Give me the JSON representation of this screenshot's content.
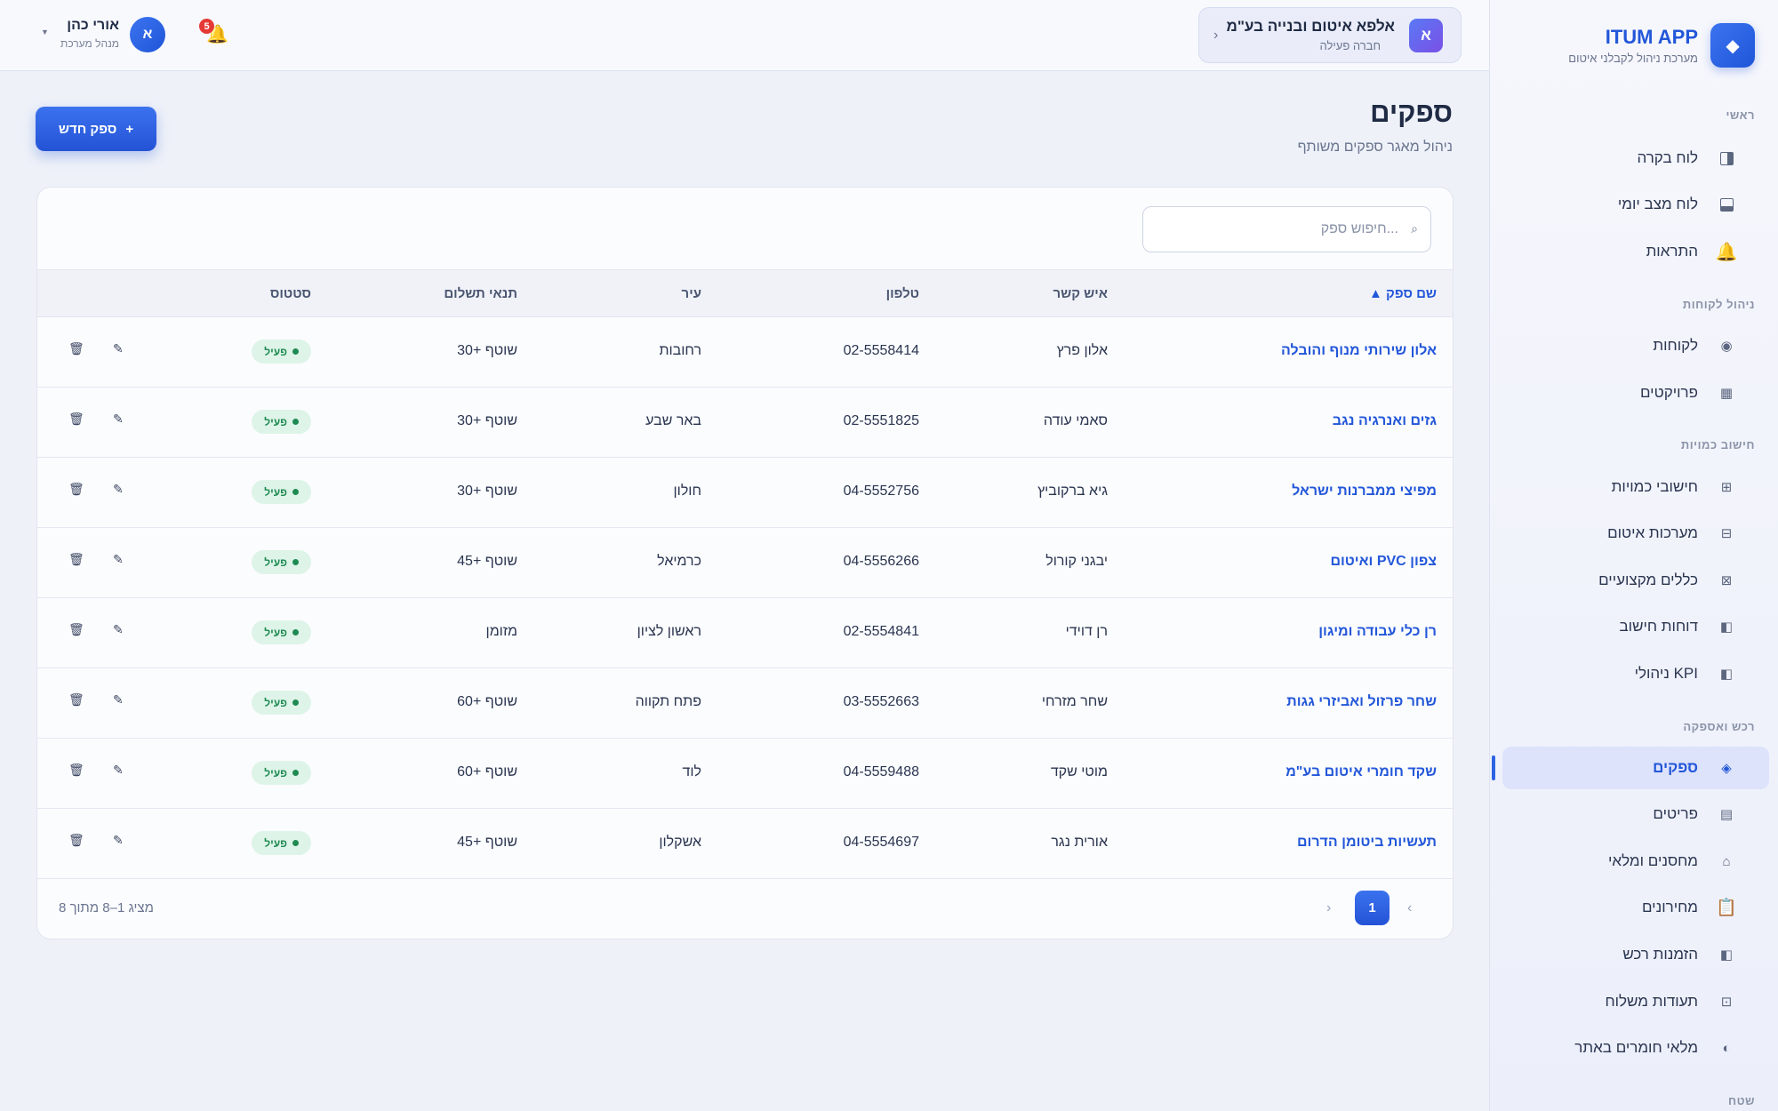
{
  "app": {
    "title": "ITUM APP",
    "subtitle": "מערכת ניהול לקבלני איטום",
    "logo_icon": "diamond-icon"
  },
  "sidebar": {
    "sections": [
      {
        "label": "ראשי"
      },
      {
        "label": "ניהול לקוחות"
      },
      {
        "label": "חישוב כמויות"
      },
      {
        "label": "רכש ואספקה"
      },
      {
        "label": "שטח"
      }
    ],
    "items": [
      {
        "label": "לוח בקרה",
        "icon": "dashboard-icon"
      },
      {
        "label": "לוח מצב יומי",
        "icon": "daily-board-icon"
      },
      {
        "label": "התראות",
        "icon": "bell-icon"
      },
      {
        "label": "לקוחות",
        "icon": "customers-icon"
      },
      {
        "label": "פרויקטים",
        "icon": "projects-icon"
      },
      {
        "label": "חישובי כמויות",
        "icon": "calc-grid-icon"
      },
      {
        "label": "מערכות איטום",
        "icon": "systems-icon"
      },
      {
        "label": "כללים מקצועיים",
        "icon": "rules-icon"
      },
      {
        "label": "דוחות חישוב",
        "icon": "report-icon"
      },
      {
        "label": "KPI ניהולי",
        "icon": "kpi-icon"
      },
      {
        "label": "ספקים",
        "icon": "suppliers-icon",
        "active": true
      },
      {
        "label": "פריטים",
        "icon": "items-icon"
      },
      {
        "label": "מחסנים ומלאי",
        "icon": "warehouse-icon"
      },
      {
        "label": "מחירונים",
        "icon": "clipboard-icon"
      },
      {
        "label": "הזמנות רכש",
        "icon": "purchase-icon"
      },
      {
        "label": "תעודות משלוח",
        "icon": "delivery-icon"
      },
      {
        "label": "מלאי חומרים באתר",
        "icon": "site-stock-icon"
      }
    ]
  },
  "topbar": {
    "company": {
      "avatar": "א",
      "name": "אלפא איטום ובנייה בע\"מ",
      "status": "חברה פעילה"
    },
    "user": {
      "avatar": "א",
      "name": "אורי כהן",
      "role": "מנהל מערכת"
    },
    "notifications": {
      "count": "5"
    }
  },
  "page": {
    "title": "ספקים",
    "subtitle": "ניהול מאגר ספקים משותף",
    "new_button": "ספק חדש",
    "new_button_icon": "+"
  },
  "search": {
    "placeholder": "...חיפוש ספק",
    "value": ""
  },
  "table": {
    "columns": [
      "שם ספק ▲",
      "איש קשר",
      "טלפון",
      "עיר",
      "תנאי תשלום",
      "סטטוס"
    ],
    "sorted_column": "שם ספק",
    "rows": [
      {
        "name": "אלון שירותי מנוף והובלה",
        "contact": "אלון פרץ",
        "phone": "02-5558414",
        "city": "רחובות",
        "terms": "שוטף +30",
        "status": "פעיל"
      },
      {
        "name": "גזים ואנרגיה נגב",
        "contact": "סאמי עודה",
        "phone": "02-5551825",
        "city": "באר שבע",
        "terms": "שוטף +30",
        "status": "פעיל"
      },
      {
        "name": "מפיצי ממברנות ישראל",
        "contact": "גיא ברקוביץ",
        "phone": "04-5552756",
        "city": "חולון",
        "terms": "שוטף +30",
        "status": "פעיל"
      },
      {
        "name": "צפון PVC ואיטום",
        "contact": "יבגני קורול",
        "phone": "04-5556266",
        "city": "כרמיאל",
        "terms": "שוטף +45",
        "status": "פעיל"
      },
      {
        "name": "רן כלי עבודה ומיגון",
        "contact": "רן דוידי",
        "phone": "02-5554841",
        "city": "ראשון לציון",
        "terms": "מזומן",
        "status": "פעיל"
      },
      {
        "name": "שחר פרזול ואביזרי גגות",
        "contact": "שחר מזרחי",
        "phone": "03-5552663",
        "city": "פתח תקווה",
        "terms": "שוטף +60",
        "status": "פעיל"
      },
      {
        "name": "שקד חומרי איטום בע\"מ",
        "contact": "מוטי שקד",
        "phone": "04-5559488",
        "city": "לוד",
        "terms": "שוטף +60",
        "status": "פעיל"
      },
      {
        "name": "תעשיות ביטומן הדרום",
        "contact": "אורית נגר",
        "phone": "04-5554697",
        "city": "אשקלון",
        "terms": "שוטף +45",
        "status": "פעיל"
      }
    ]
  },
  "pagination": {
    "info": "מציג 1–8 מתוך 8",
    "current": "1"
  },
  "colors": {
    "primary": "#2357d9",
    "success": "#1e8a52",
    "success_bg": "#def4e8",
    "badge": "#e53935"
  }
}
